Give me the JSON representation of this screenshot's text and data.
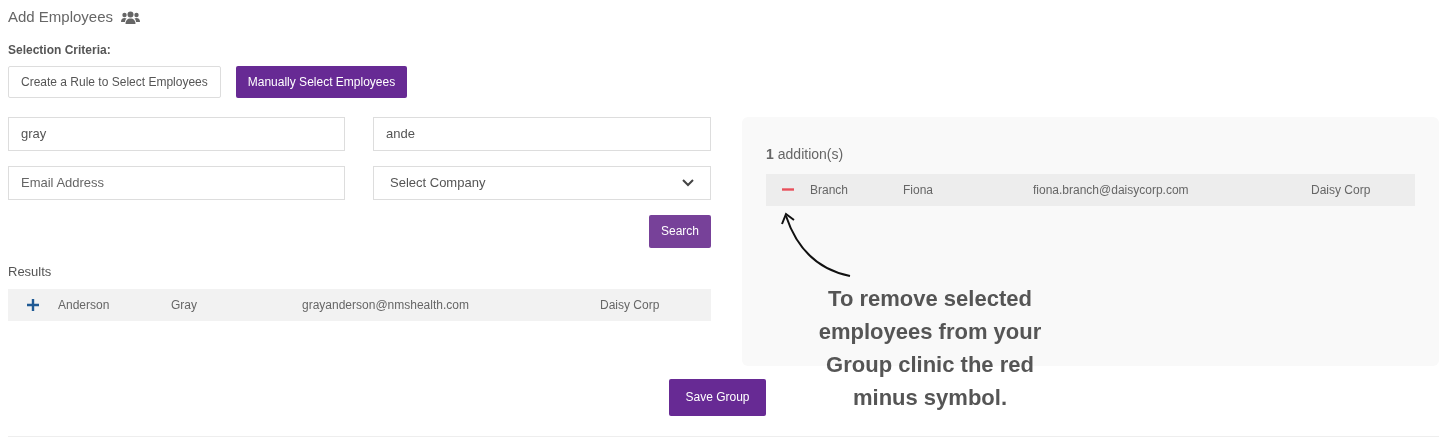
{
  "title": "Add Employees",
  "criteria_label": "Selection Criteria:",
  "criteria_tabs": [
    {
      "label": "Create a Rule to Select Employees",
      "selected": false
    },
    {
      "label": "Manually Select Employees",
      "selected": true
    }
  ],
  "fields": [
    {
      "kind": "text",
      "value": "gray"
    },
    {
      "kind": "text",
      "value": "ande"
    },
    {
      "kind": "text",
      "placeholder": "Email Address"
    },
    {
      "kind": "select",
      "value": "Select Company"
    }
  ],
  "search_button": "Search",
  "results": {
    "label": "Results",
    "rows": [
      {
        "kind": "add",
        "last": "Anderson",
        "first": "Gray",
        "email": "grayanderson@nmshealth.com",
        "company": "Daisy Corp"
      }
    ]
  },
  "additions": {
    "count": "1",
    "label": "addition(s)",
    "rows": [
      {
        "kind": "remove",
        "last": "Branch",
        "first": "Fiona",
        "email": "fiona.branch@daisycorp.com",
        "company": "Daisy Corp"
      }
    ]
  },
  "save_button": "Save Group",
  "callout": "To remove selected employees from your Group clinic the red minus symbol."
}
